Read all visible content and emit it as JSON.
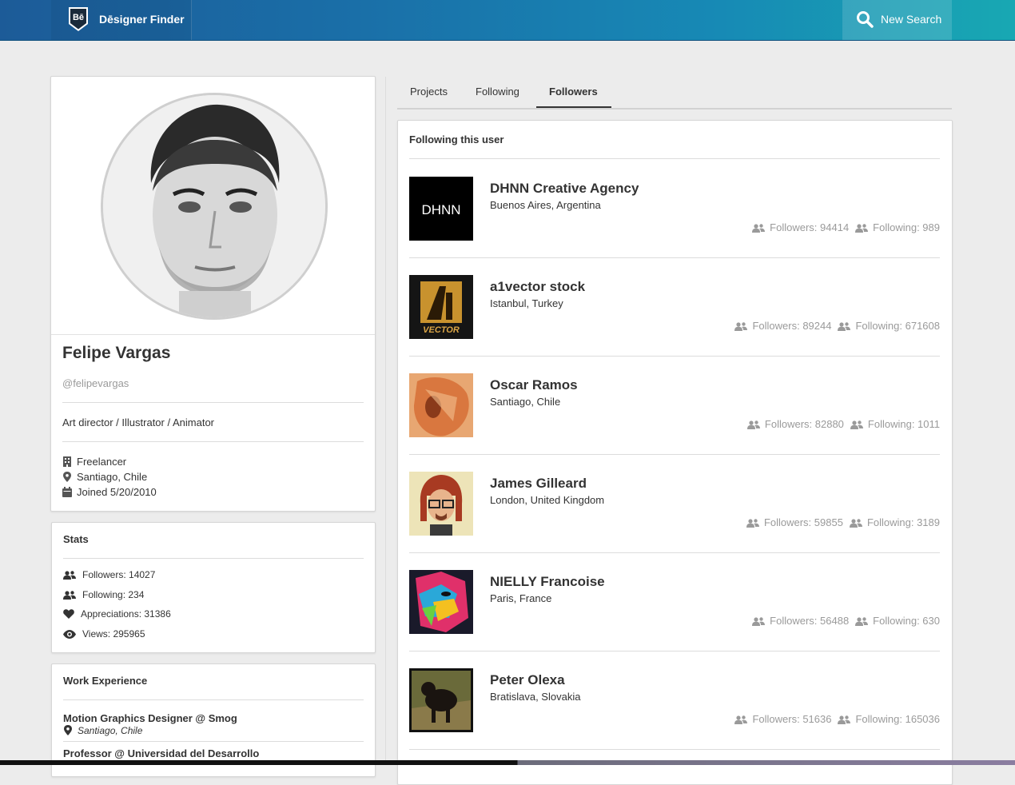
{
  "header": {
    "brand_name": "Dēsigner Finder",
    "logo_text": "Bē",
    "new_search_label": "New Search"
  },
  "profile": {
    "name": "Felipe Vargas",
    "handle": "@felipevargas",
    "role": "Art director / Illustrator / Animator",
    "status": "Freelancer",
    "location": "Santiago, Chile",
    "joined": "Joined 5/20/2010"
  },
  "stats": {
    "title": "Stats",
    "followers": "Followers: 14027",
    "following": "Following: 234",
    "appreciations": "Appreciations: 31386",
    "views": "Views: 295965"
  },
  "work": {
    "title": "Work Experience",
    "jobs": [
      {
        "title": "Motion Graphics Designer @ Smog",
        "location": "Santiago, Chile"
      },
      {
        "title": "Professor @ Universidad del Desarrollo"
      }
    ]
  },
  "tabs": [
    {
      "label": "Projects"
    },
    {
      "label": "Following"
    },
    {
      "label": "Followers"
    }
  ],
  "active_tab": "Followers",
  "following_section": {
    "title": "Following this user",
    "users": [
      {
        "name": "DHNN Creative Agency",
        "location": "Buenos Aires, Argentina",
        "followers": "Followers: 94414",
        "following": "Following: 989",
        "thumb_text": "DHNN"
      },
      {
        "name": "a1vector stock",
        "location": "Istanbul, Turkey",
        "followers": "Followers: 89244",
        "following": "Following: 671608",
        "thumb_text": "VECTOR"
      },
      {
        "name": "Oscar Ramos",
        "location": "Santiago, Chile",
        "followers": "Followers: 82880",
        "following": "Following: 1011"
      },
      {
        "name": "James Gilleard",
        "location": "London, United Kingdom",
        "followers": "Followers: 59855",
        "following": "Following: 3189"
      },
      {
        "name": "NIELLY Francoise",
        "location": "Paris, France",
        "followers": "Followers: 56488",
        "following": "Following: 630"
      },
      {
        "name": "Peter Olexa",
        "location": "Bratislava, Slovakia",
        "followers": "Followers: 51636",
        "following": "Following: 165036"
      }
    ]
  },
  "colors": {
    "header_start": "#1c5b98",
    "header_end": "#18a8b3",
    "page_bg": "#ececec",
    "muted_text": "#9a9a9a"
  }
}
